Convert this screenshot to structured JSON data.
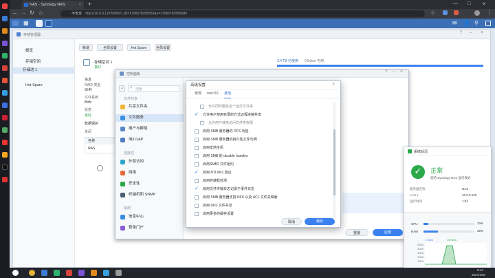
{
  "browser": {
    "tab_title": "NAS - Synology NAS",
    "url": "http://10.0.0.120:5000/?_dc=1706578356555&s=1706578356568#",
    "url_prefix": "不安全"
  },
  "storage_manager": {
    "title": "存储管理器",
    "sidebar": [
      {
        "label": "概览"
      },
      {
        "label": "存储空间"
      },
      {
        "label": "存储池 1"
      },
      {
        "label": "Hot Spare"
      }
    ],
    "toolbar": [
      "新增",
      "全局设置",
      "Hot Spare",
      "全局设置"
    ],
    "volume_title": "存储空间 1",
    "volume_status": "良好",
    "volume_usage": "3.4 TB 已使用",
    "volume_free": "0 Bytes 可用",
    "section_labels": [
      "信息",
      "RAID 类型",
      "文件系统",
      "状态",
      "数据保护",
      "关闭"
    ],
    "info_values": [
      "Btrfs",
      "SHR",
      "良好"
    ],
    "table_headers": [
      "名称",
      "类型"
    ],
    "table_row": "NAS"
  },
  "control_panel": {
    "title": "控制面板",
    "search_placeholder": "搜索",
    "groups": [
      "文件共享",
      "连接性",
      "系统"
    ],
    "items": [
      "共享文件夹",
      "文件服务",
      "用户与群组",
      "域/LDAP",
      "外部访问",
      "网络",
      "安全性",
      "终端机和 SNMP",
      "信息中心",
      "登录门户"
    ],
    "apply_button": "应用",
    "reset_button": "重置"
  },
  "advanced_dialog": {
    "title": "高级设置",
    "tabs": [
      "常规",
      "macOS",
      "其他"
    ],
    "options": [
      {
        "label": "允许同时服务这个运行文件夹",
        "checked": false,
        "indent": 1
      },
      {
        "label": "允许用户使用目录的方式远程连接共享",
        "checked": true,
        "indent": 0
      },
      {
        "label": "允许用户转换访问文件夹权限",
        "checked": false,
        "indent": 1
      },
      {
        "label": "启用 SMB 服务器的 DFS 功能",
        "checked": false,
        "indent": 0
      },
      {
        "label": "启用 SMB 服务器的持久性文件句柄",
        "checked": false,
        "indent": 0
      },
      {
        "label": "启用本地主机",
        "checked": false,
        "indent": 0
      },
      {
        "label": "启用 SMB 的 durable handles",
        "checked": false,
        "indent": 0
      },
      {
        "label": "启用SMB2 文件租约",
        "checked": false,
        "indent": 0
      },
      {
        "label": "启用 NTLMv1 验证",
        "checked": true,
        "indent": 0
      },
      {
        "label": "启用终端机检测",
        "checked": false,
        "indent": 0
      },
      {
        "label": "启用文件传输日志记录于事件日志",
        "checked": true,
        "indent": 0
      },
      {
        "label": "启用 SMB 服务器支持 NFS 以及 ACL 文件夹映射",
        "checked": false,
        "indent": 0
      },
      {
        "label": "启用 DFS 文件共享",
        "checked": false,
        "indent": 0
      },
      {
        "label": "启用更多的缓存设置",
        "checked": false,
        "indent": 0
      }
    ],
    "cancel_button": "取消",
    "save_button": "保存"
  },
  "resource_monitor": {
    "title": "系统状况",
    "status": "正常",
    "status_desc": "您的 Synology NAS 运行良好",
    "rows": [
      {
        "k": "服务器名称",
        "v": "NAS"
      },
      {
        "k": "LAN 1",
        "v": "10.0.0.120"
      },
      {
        "k": "运行时间",
        "v": "1:04"
      }
    ],
    "cpu_label": "CPU",
    "cpu_value": "10%",
    "ram_label": "RAM",
    "ram_value": "29%",
    "net_up": "1 KB/s",
    "net_down": "15 KB/s",
    "y_ticks": [
      "5000",
      "4000",
      "3000",
      "2000",
      "1000",
      "0"
    ]
  },
  "taskbar": {
    "time": "9:44",
    "date": "2024/1/30"
  },
  "colors": {
    "accent": "#3b82f0",
    "dsm_topbar": "#3b6fb6",
    "ok_green": "#2aa84a"
  }
}
